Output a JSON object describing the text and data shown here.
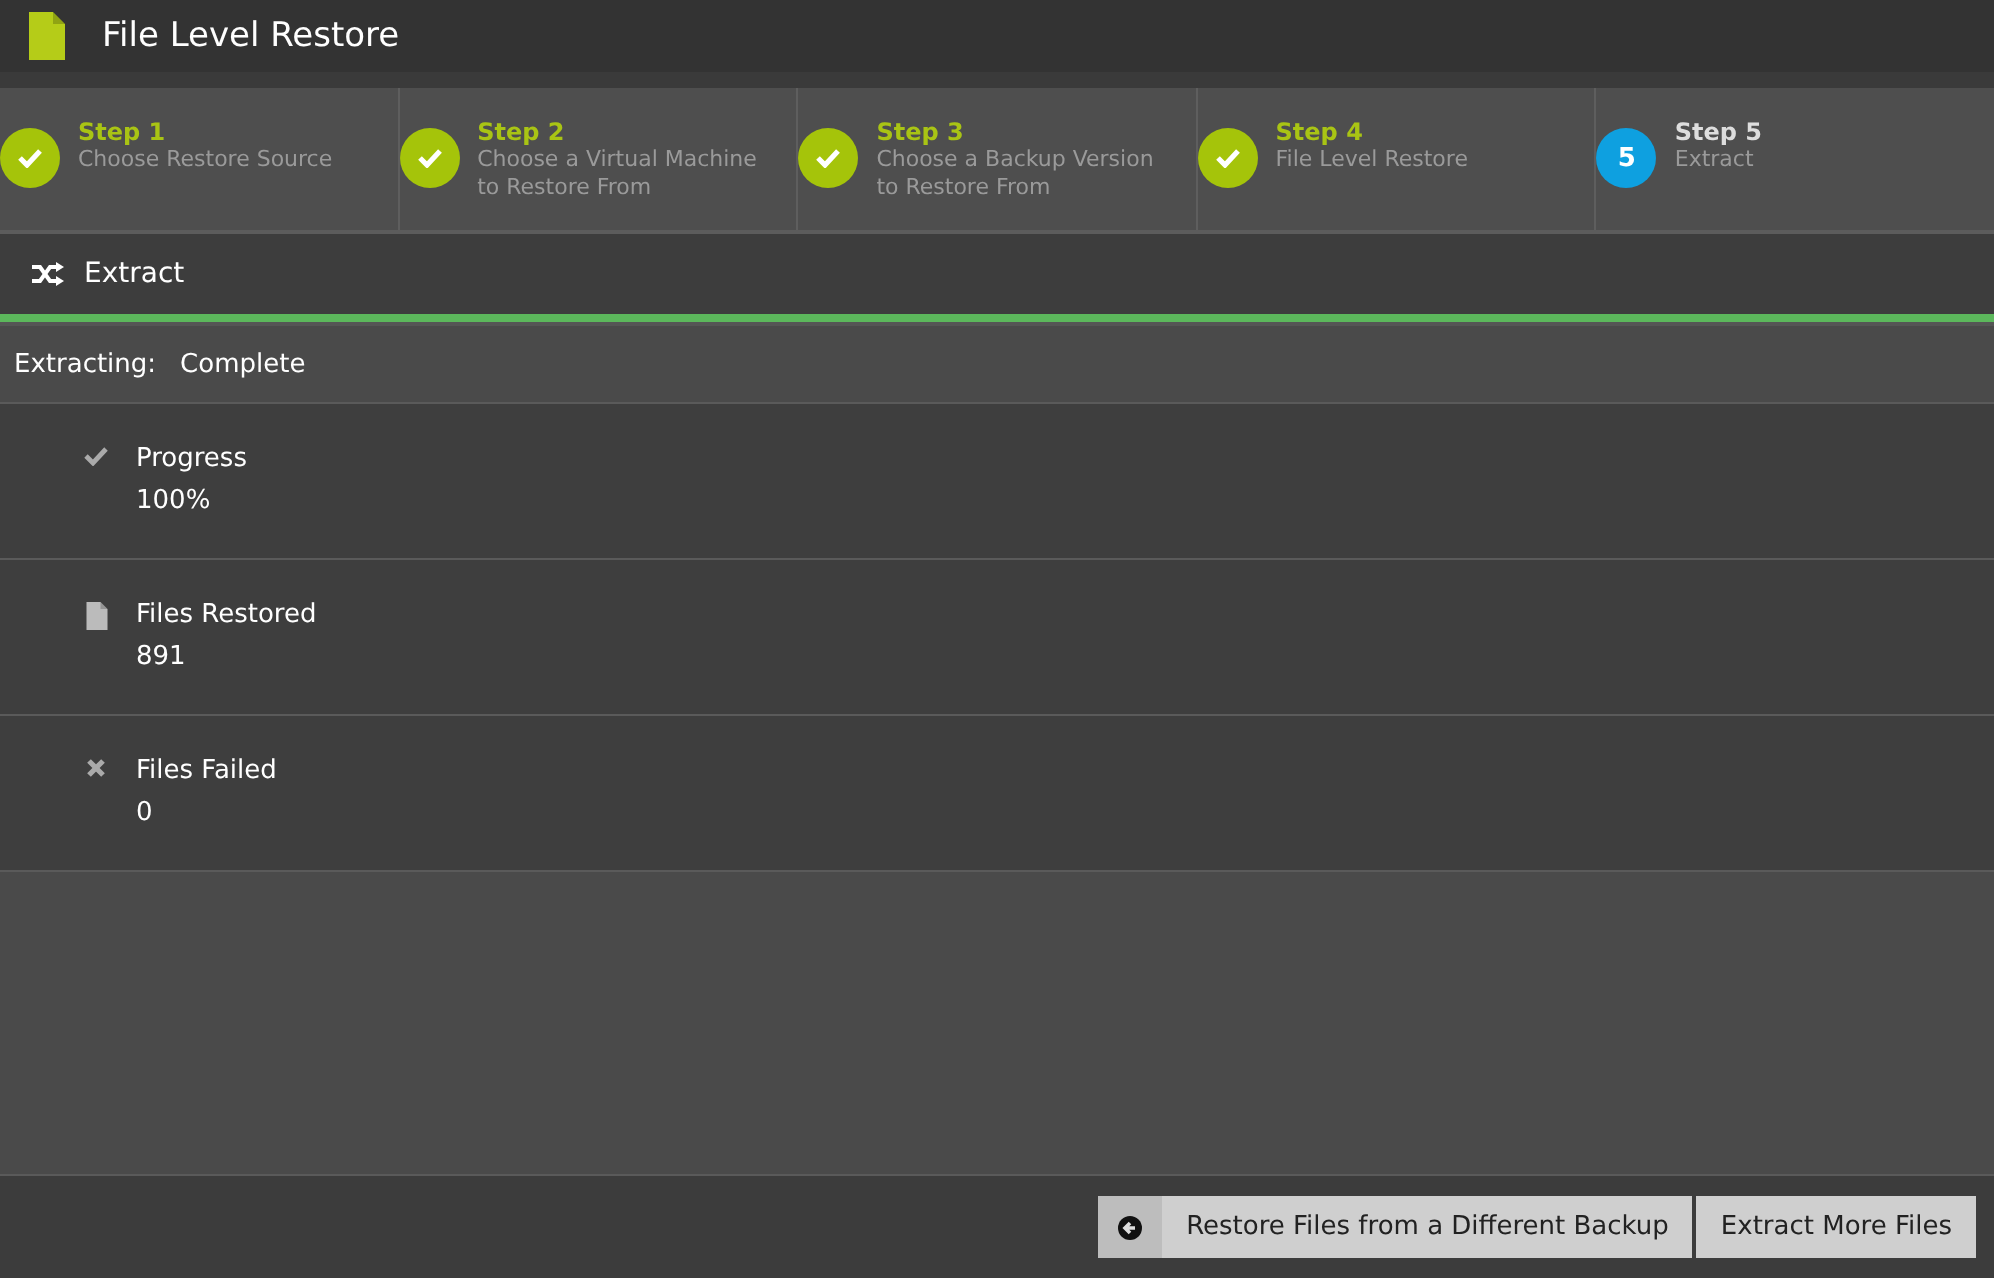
{
  "header": {
    "title": "File Level Restore"
  },
  "steps": [
    {
      "label": "Step 1",
      "description": "Choose Restore Source",
      "completed": true
    },
    {
      "label": "Step 2",
      "description": "Choose a Virtual Machine to Restore From",
      "completed": true
    },
    {
      "label": "Step 3",
      "description": "Choose a Backup Version to Restore From",
      "completed": true
    },
    {
      "label": "Step 4",
      "description": "File Level Restore",
      "completed": true
    },
    {
      "label": "Step 5",
      "description": "Extract",
      "completed": false,
      "number": "5"
    }
  ],
  "section": {
    "title": "Extract"
  },
  "progress_bar": {
    "level": 1
  },
  "status": {
    "label": "Extracting:",
    "value": "Complete"
  },
  "results": [
    {
      "kind": "check",
      "label": "Progress",
      "value": "100%"
    },
    {
      "kind": "file",
      "label": "Files Restored",
      "value": "891"
    },
    {
      "kind": "cross",
      "label": "Files Failed",
      "value": "0"
    }
  ],
  "buttons": [
    {
      "label": "Restore Files from a Different Backup",
      "kind": "back"
    },
    {
      "label": "Extract More Files",
      "kind": "plain"
    }
  ]
}
